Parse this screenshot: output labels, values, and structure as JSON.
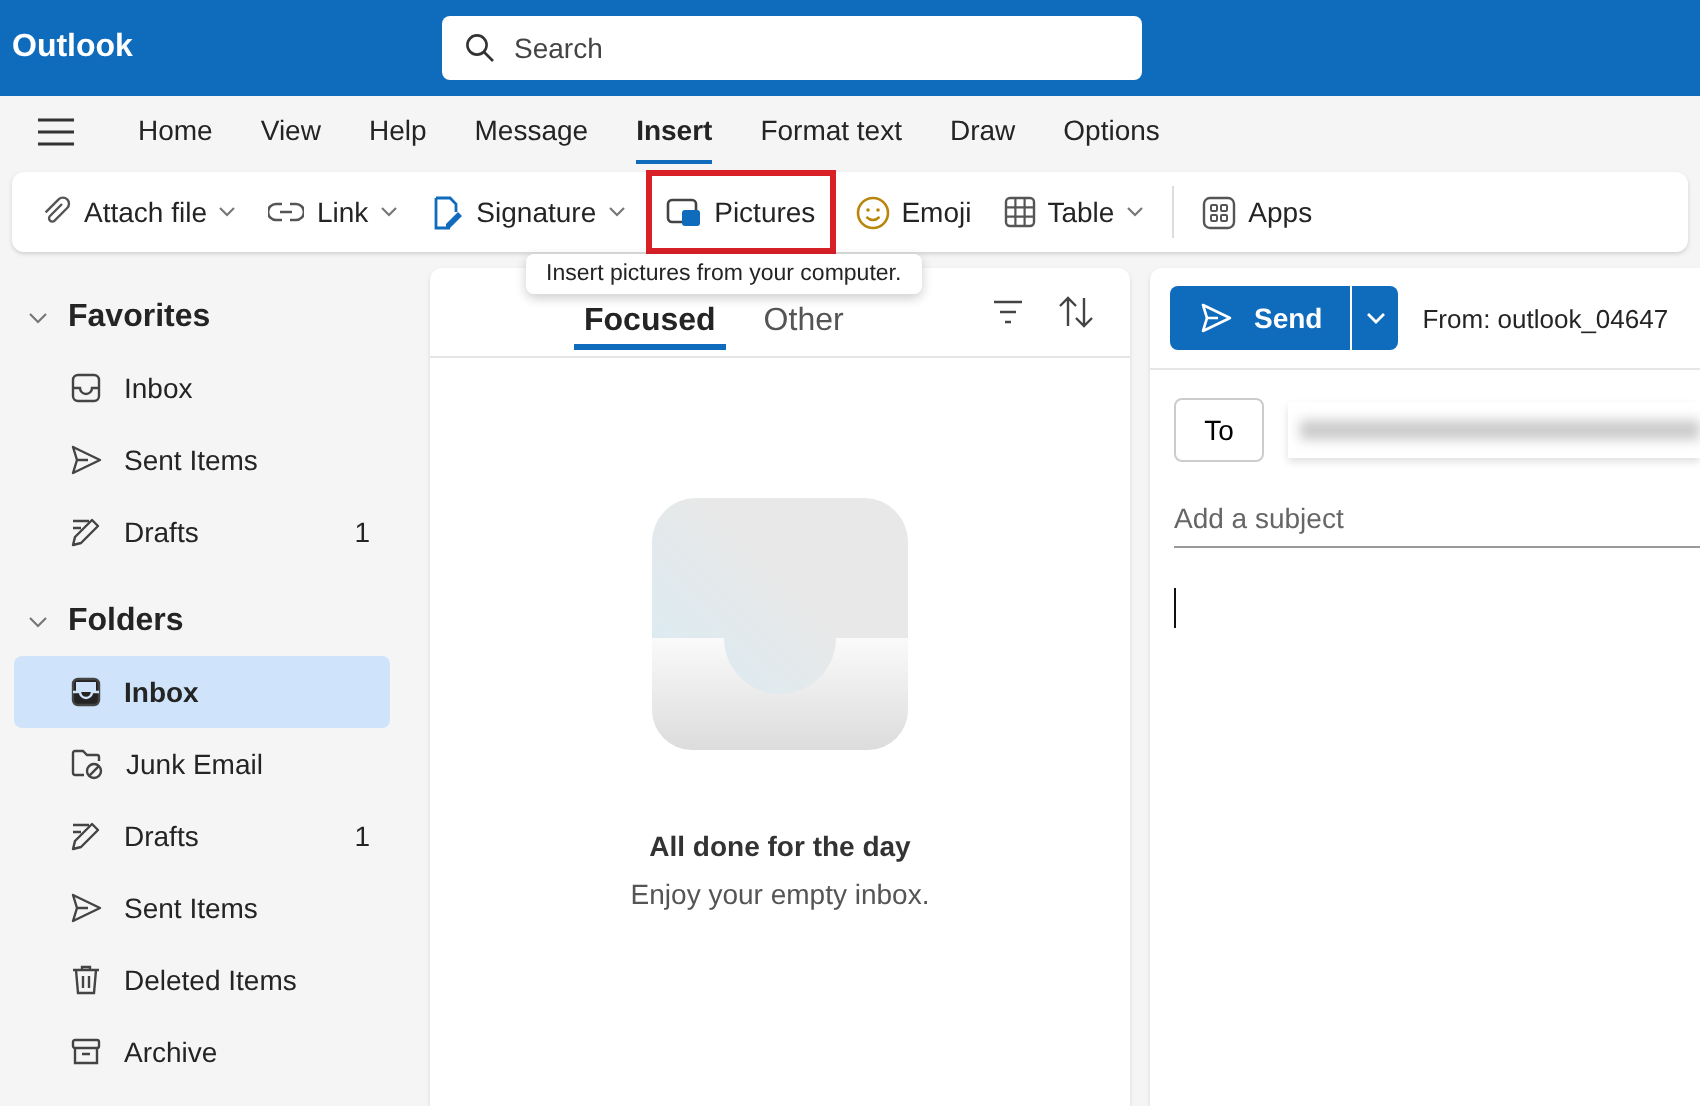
{
  "app_bar": {
    "title": "Outlook",
    "search": {
      "placeholder": "Search"
    }
  },
  "ribbon_tabs": [
    {
      "label": "Home",
      "selected": false
    },
    {
      "label": "View",
      "selected": false
    },
    {
      "label": "Help",
      "selected": false
    },
    {
      "label": "Message",
      "selected": false
    },
    {
      "label": "Insert",
      "selected": true
    },
    {
      "label": "Format text",
      "selected": false
    },
    {
      "label": "Draw",
      "selected": false
    },
    {
      "label": "Options",
      "selected": false
    }
  ],
  "toolbar": [
    {
      "label": "Attach file",
      "has_menu": true,
      "highlighted": false
    },
    {
      "label": "Link",
      "has_menu": true,
      "highlighted": false
    },
    {
      "label": "Signature",
      "has_menu": true,
      "highlighted": false
    },
    {
      "label": "Pictures",
      "has_menu": false,
      "highlighted": true
    },
    {
      "label": "Emoji",
      "has_menu": false,
      "highlighted": false
    },
    {
      "label": "Table",
      "has_menu": true,
      "highlighted": false
    },
    {
      "label": "Apps",
      "has_menu": false,
      "highlighted": false
    }
  ],
  "tooltip": "Insert pictures from your computer.",
  "sidebar": [
    {
      "title": "Favorites",
      "expanded": true,
      "items": [
        {
          "label": "Inbox",
          "kind": "inbox",
          "selected": false
        },
        {
          "label": "Sent Items",
          "kind": "sent",
          "selected": false
        },
        {
          "label": "Drafts",
          "kind": "drafts",
          "count": "1",
          "selected": false
        }
      ]
    },
    {
      "title": "Folders",
      "expanded": true,
      "items": [
        {
          "label": "Inbox",
          "kind": "inbox",
          "selected": true
        },
        {
          "label": "Junk Email",
          "kind": "junk",
          "selected": false
        },
        {
          "label": "Drafts",
          "kind": "drafts",
          "count": "1",
          "selected": false
        },
        {
          "label": "Sent Items",
          "kind": "sent",
          "selected": false
        },
        {
          "label": "Deleted Items",
          "kind": "trash",
          "selected": false
        },
        {
          "label": "Archive",
          "kind": "archive",
          "selected": false
        }
      ]
    }
  ],
  "message_list": {
    "tabs": [
      {
        "label": "Focused",
        "selected": true
      },
      {
        "label": "Other",
        "selected": false
      }
    ],
    "empty_title": "All done for the day",
    "empty_subtitle": "Enjoy your empty inbox."
  },
  "compose": {
    "send": "Send",
    "from": "From: outlook_04647",
    "to_button": "To",
    "subject": {
      "placeholder": "Add a subject"
    }
  }
}
